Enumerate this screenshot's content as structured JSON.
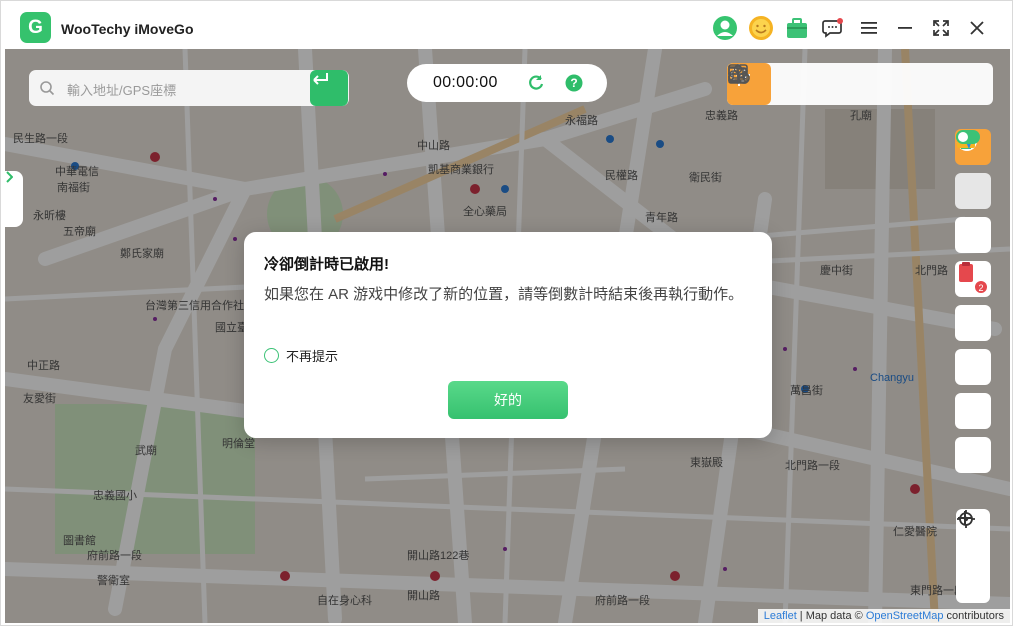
{
  "app": {
    "title": "WooTechy iMoveGo",
    "logo_letter": "G"
  },
  "titlebar": {
    "icons": [
      "user-icon",
      "emoji-icon",
      "toolbox-icon",
      "feedback-icon",
      "menu-icon",
      "minimize-icon",
      "fullscreen-icon",
      "close-icon"
    ]
  },
  "search": {
    "placeholder": "輸入地址/GPS座標"
  },
  "timer": {
    "time": "00:00:00"
  },
  "mode_tools": [
    "teleport-mode-icon",
    "joystick-mode-icon",
    "multi-spot-icon",
    "route-icon",
    "jump-teleport-icon",
    "history-icon"
  ],
  "side_tools": [
    "pokemon-icon",
    "layers-icon",
    "freeze-icon",
    "cooldown-icon",
    "shirt-icon",
    "wallet-icon",
    "send-icon",
    "toggle-icon"
  ],
  "side_badge": "2",
  "attribution": {
    "leaflet": "Leaflet",
    "sep": " | Map data © ",
    "osm": "OpenStreetMap",
    "tail": " contributors"
  },
  "map_labels": [
    "民生路一段",
    "中華電信",
    "南福街",
    "永昕樓",
    "五帝廟",
    "鄭氏家廟",
    "台灣第三信用合作社",
    "國立臺灣文學館",
    "友愛街",
    "中正路",
    "武廟",
    "明倫堂",
    "忠義國小",
    "圖書館",
    "府前路一段",
    "警衛室",
    "自在身心科",
    "開山路",
    "全心藥局",
    "凱基商業銀行",
    "中山路",
    "開山路122巷",
    "東嶽殿",
    "府前路一段",
    "北門路一段",
    "萬昌街",
    "Changyu",
    "仁愛醫院",
    "東門路一段",
    "永福路",
    "民權路",
    "青年路",
    "孔廟",
    "忠義路",
    "衛民街",
    "慶中街",
    "北門路"
  ],
  "colors": {
    "accent": "#2fbd6a",
    "active_mode": "#f7a23a"
  },
  "dialog": {
    "title": "冷卻倒計時已啟用!",
    "body": "如果您在 AR 游戏中修改了新的位置，請等倒數計時結束後再執行動作。",
    "checkbox_label": "不再提示",
    "ok_button": "好的"
  }
}
